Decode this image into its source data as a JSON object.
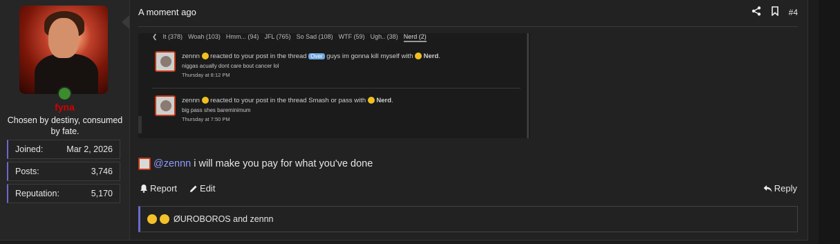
{
  "user": {
    "name": "fyna",
    "title": "Chosen by destiny, consumed by fate.",
    "stats": [
      {
        "label": "Joined:",
        "value": "Mar 2, 2026"
      },
      {
        "label": "Posts:",
        "value": "3,746"
      },
      {
        "label": "Reputation:",
        "value": "5,170"
      }
    ]
  },
  "header": {
    "timestamp": "A moment ago",
    "post_number": "#4"
  },
  "embed": {
    "tabs": [
      "It (378)",
      "Woah (103)",
      "Hmm... (94)",
      "JFL (765)",
      "So Sad (108)",
      "WTF (59)",
      "Ugh.. (38)",
      "Nerd (2)"
    ],
    "notifications": [
      {
        "pre": "zennn",
        "text1": "reacted to your post in the thread",
        "badge": "Over",
        "text2": "guys im gonna kill myself with",
        "reaction": "Nerd",
        "snippet": "niggas acually dont care bout cancer lol",
        "time": "Thursday at 8:12 PM"
      },
      {
        "pre": "zennn",
        "text1": "reacted to your post in the thread Smash or pass with",
        "badge": "",
        "text2": "",
        "reaction": "Nerd",
        "snippet": "big pass shes bareminimum",
        "time": "Thursday at 7:50 PM"
      }
    ]
  },
  "message": {
    "mention": "@zennn",
    "text": "i will make you pay for what you've done"
  },
  "actions": {
    "report": "Report",
    "edit": "Edit",
    "reply": "Reply"
  },
  "reactions": {
    "summary": "ØUROBOROS and zennn"
  }
}
